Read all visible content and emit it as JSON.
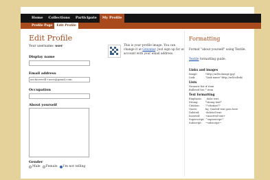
{
  "nav": {
    "items": [
      {
        "label": "Home",
        "active": false
      },
      {
        "label": "Collections",
        "active": false
      },
      {
        "label": "Participate",
        "active": false
      },
      {
        "label": "My Profile",
        "active": true
      }
    ]
  },
  "subnav": {
    "items": [
      {
        "label": "Profile Page",
        "active": false
      },
      {
        "label": "Edit Profile",
        "active": true
      }
    ]
  },
  "form": {
    "title": "Edit Profile",
    "username_prefix": "Your username:",
    "username": "user",
    "display_name_label": "Display name",
    "display_name_value": "",
    "email_label": "Email address",
    "email_value": "archivewell+user@gmail.com",
    "occupation_label": "Occupation",
    "occupation_value": "",
    "about_label": "About yourself",
    "gender_label": "Gender",
    "gender_options": [
      "Male",
      "Female",
      "I'm not telling"
    ],
    "gender_selected": "I'm not telling"
  },
  "avatar": {
    "text_before": "This is your profile image. You can change it at",
    "link": "Gravatar",
    "text_after": ". Just sign up for an account with your email address."
  },
  "formatting": {
    "title": "Formatting",
    "intro": "Format \"about yourself\" using Textile.",
    "guide_link": "Textile",
    "guide_suffix": "formatting guide.",
    "links_heading": "Links and images",
    "links_rows": [
      {
        "k": "Image:",
        "v": "!http://url/to/image.jpg!"
      },
      {
        "k": "Link:",
        "v": "\"Link name\":http://url/to/link/"
      }
    ],
    "lists_heading": "Lists",
    "lists_rows": [
      {
        "k": "Numeric list:",
        "v": "# item"
      },
      {
        "k": "Bulleted list:",
        "v": "* item"
      }
    ],
    "text_heading": "Text formatting",
    "text_rows": [
      {
        "k": "Emphasis:",
        "v": "_italic text_"
      },
      {
        "k": "Strong:",
        "v": "*strong text*"
      },
      {
        "k": "Citation:",
        "v": "??citation??"
      },
      {
        "k": "Quote:",
        "v": "bq. Quoted text goes here"
      },
      {
        "k": "Deleted:",
        "v": "-deleted text-"
      },
      {
        "k": "Inserted:",
        "v": "+inserted text+"
      },
      {
        "k": "Superscript:",
        "v": "^superscript^"
      },
      {
        "k": "Subscript:",
        "v": "~subscript~"
      }
    ]
  },
  "colors": {
    "background": "#e4d29a",
    "nav_bg": "#141414",
    "accent": "#a84a1c",
    "link": "#1a4db3"
  }
}
